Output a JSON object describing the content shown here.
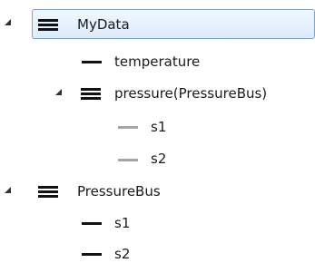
{
  "tree": {
    "nodes": [
      {
        "id": "mydata",
        "label": "MyData",
        "icon": "struct-icon",
        "expanded": true,
        "selected": true
      },
      {
        "id": "temperature",
        "label": "temperature",
        "icon": "signal-icon"
      },
      {
        "id": "pressure",
        "label": "pressure(PressureBus)",
        "icon": "struct-icon",
        "expanded": true
      },
      {
        "id": "pressure-s1",
        "label": "s1",
        "icon": "signal-icon-inherited"
      },
      {
        "id": "pressure-s2",
        "label": "s2",
        "icon": "signal-icon-inherited"
      },
      {
        "id": "pressurebus",
        "label": "PressureBus",
        "icon": "struct-icon",
        "expanded": true
      },
      {
        "id": "pressurebus-s1",
        "label": "s1",
        "icon": "signal-icon"
      },
      {
        "id": "pressurebus-s2",
        "label": "s2",
        "icon": "signal-icon"
      }
    ]
  },
  "colors": {
    "selection_border": "#7da2ce",
    "selection_fill": "#dcebfc",
    "signal_line": "#111111",
    "inherited_signal_line": "#a6a6a6"
  }
}
